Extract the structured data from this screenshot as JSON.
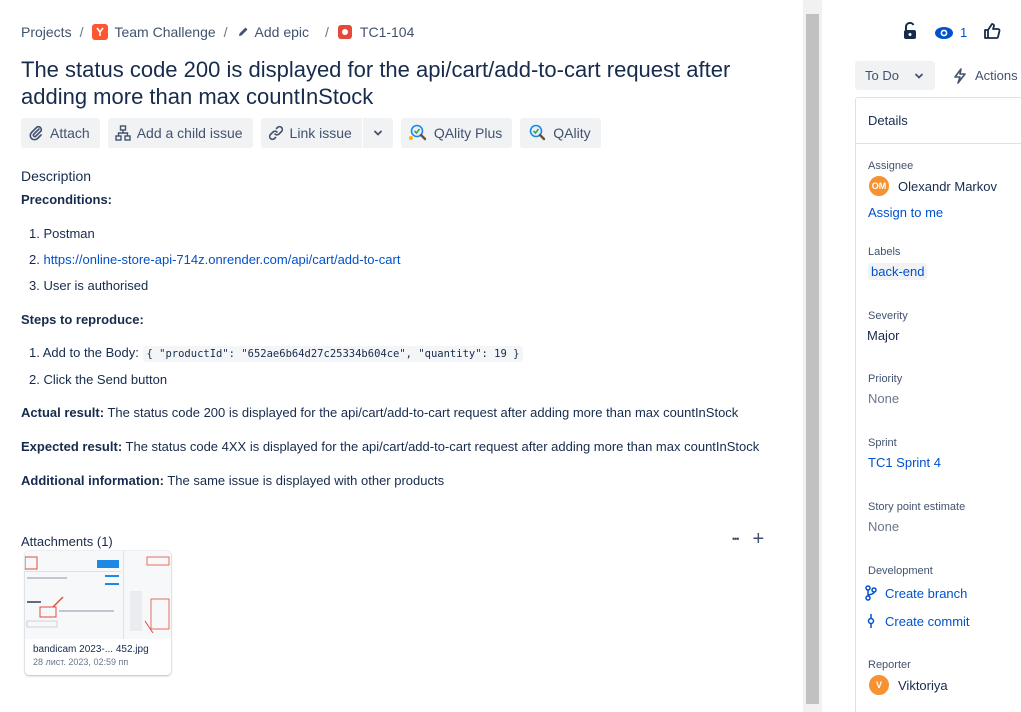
{
  "breadcrumbs": {
    "projects": "Projects",
    "project": "Team Challenge",
    "epic": "Add epic",
    "issue_key": "TC1-104"
  },
  "title": "The status code 200 is displayed for the api/cart/add-to-cart request after adding more than max countInStock",
  "toolbar": {
    "attach": "Attach",
    "add_child": "Add a child issue",
    "link_issue": "Link issue",
    "qality_plus": "QAlity Plus",
    "qality": "QAlity"
  },
  "description": {
    "label": "Description",
    "preconditions_heading": "Preconditions:",
    "preconditions": [
      {
        "num": "1.",
        "text": "Postman"
      },
      {
        "num": "2.",
        "text": "https://online-store-api-714z.onrender.com/api/cart/add-to-cart"
      },
      {
        "num": "3.",
        "text": "User is authorised"
      }
    ],
    "steps_heading": "Steps to reproduce:",
    "steps": [
      {
        "num": "1.",
        "text": "Add to the Body:",
        "code": "{ \"productId\": \"652ae6b64d27c25334b604ce\", \"quantity\": 19 }"
      },
      {
        "num": "2.",
        "text": "Click the Send button"
      }
    ],
    "actual_label": "Actual result:",
    "actual_text": " The status code 200 is displayed for the api/cart/add-to-cart request after adding more than max countInStock",
    "expected_label": "Expected result:",
    "expected_text": " The status code 4XX is displayed for the api/cart/add-to-cart request after adding more than max countInStock",
    "additional_label": "Additional information:",
    "additional_text": " The same issue is displayed with other products"
  },
  "attachments": {
    "header": "Attachments (1)",
    "more": "•••",
    "add": "+",
    "file_name": "bandicam 2023-... 452.jpg",
    "file_date": "28 лист. 2023, 02:59 пп"
  },
  "right": {
    "watch_count": "1",
    "status": "To Do",
    "actions": "Actions",
    "details_title": "Details",
    "assignee_label": "Assignee",
    "assignee_initials": "OM",
    "assignee": "Olexandr Markov",
    "assign_to_me": "Assign to me",
    "labels_label": "Labels",
    "label_value": "back-end",
    "severity_label": "Severity",
    "severity": "Major",
    "priority_label": "Priority",
    "priority": "None",
    "sprint_label": "Sprint",
    "sprint": "TC1 Sprint 4",
    "story_points_label": "Story point estimate",
    "story_points": "None",
    "development_label": "Development",
    "create_branch": "Create branch",
    "create_commit": "Create commit",
    "reporter_label": "Reporter",
    "reporter_initials": "V",
    "reporter": "Viktoriya"
  },
  "colors": {
    "link": "#0052cc",
    "text": "#172b4d",
    "subtle": "#42526e",
    "bug": "#e5493a",
    "avatar": "#f79232"
  }
}
